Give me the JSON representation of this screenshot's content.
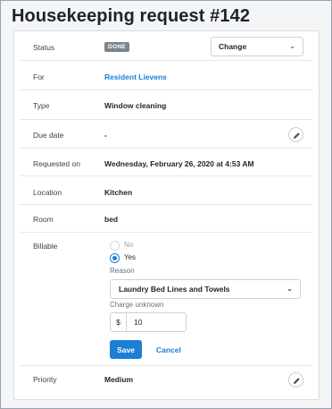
{
  "page": {
    "title": "Housekeeping request #142"
  },
  "status": {
    "label": "Status",
    "badge": "DONE",
    "change_label": "Change"
  },
  "for": {
    "label": "For",
    "value": "Resident Lievens"
  },
  "type": {
    "label": "Type",
    "value": "Window cleaning"
  },
  "due_date": {
    "label": "Due date",
    "value": "-"
  },
  "requested_on": {
    "label": "Requested on",
    "value": "Wednesday, February 26, 2020 at 4:53 AM"
  },
  "location": {
    "label": "Location",
    "value": "Kitchen"
  },
  "room": {
    "label": "Room",
    "value": "bed"
  },
  "billable": {
    "label": "Billable",
    "options": [
      "No",
      "Yes"
    ],
    "selected": "Yes",
    "reason_label": "Reason",
    "reason_value": "Laundry Bed Lines and Towels",
    "charge_label": "Charge unknown",
    "currency": "$",
    "amount": "10",
    "save_label": "Save",
    "cancel_label": "Cancel"
  },
  "priority": {
    "label": "Priority",
    "value": "Medium"
  },
  "colors": {
    "accent": "#1b7fd6",
    "badge": "#7b8590"
  },
  "icons": {
    "edit": "pencil-icon",
    "dropdown": "chevron-down-icon"
  }
}
